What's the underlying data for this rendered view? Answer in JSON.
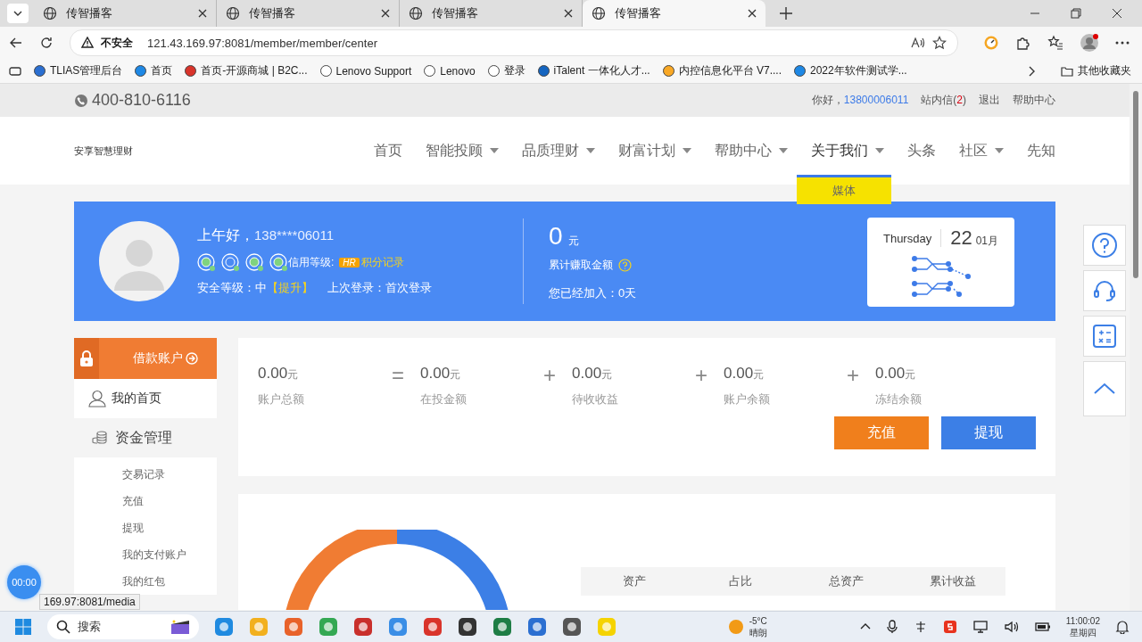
{
  "browser": {
    "tabs": [
      {
        "title": "传智播客",
        "selected": false
      },
      {
        "title": "传智播客",
        "selected": false
      },
      {
        "title": "传智播客",
        "selected": false
      },
      {
        "title": "传智播客",
        "selected": true
      }
    ],
    "address": {
      "warning": "不安全",
      "url": "121.43.169.97:8081/member/member/center"
    },
    "bookmarks": [
      "TLIAS管理后台",
      "首页",
      "首页-开源商城 | B2C...",
      "Lenovo Support",
      "Lenovo",
      "登录",
      "iTalent 一体化人才...",
      "内控信息化平台 V7....",
      "2022年软件测试学..."
    ],
    "other_bookmarks": "其他收藏夹"
  },
  "topbar": {
    "phone": "400-810-6116",
    "greeting": "你好，",
    "user": "13800006011",
    "inbox_open": "站内信(",
    "inbox_count": "2",
    "inbox_close": ")",
    "logout": "退出",
    "help": "帮助中心"
  },
  "nav": {
    "brand": "安享智慧理财",
    "items": [
      {
        "label": "首页",
        "dropdown": false,
        "expanded": false
      },
      {
        "label": "智能投顾",
        "dropdown": true,
        "expanded": false
      },
      {
        "label": "品质理财",
        "dropdown": true,
        "expanded": false
      },
      {
        "label": "财富计划",
        "dropdown": true,
        "expanded": false
      },
      {
        "label": "帮助中心",
        "dropdown": true,
        "expanded": false
      },
      {
        "label": "关于我们",
        "dropdown": true,
        "expanded": true,
        "menu": [
          "媒体"
        ]
      },
      {
        "label": "头条",
        "dropdown": false,
        "expanded": false
      },
      {
        "label": "社区",
        "dropdown": true,
        "expanded": false
      },
      {
        "label": "先知",
        "dropdown": false,
        "expanded": false
      }
    ]
  },
  "profile": {
    "greeting": "上午好，",
    "user": "138****06011",
    "credit_label": "信用等级:",
    "credit_badge": "HR",
    "points_link": "积分记录",
    "security": "安全等级：中",
    "upgrade": "【提升】",
    "last_login": "上次登录：首次登录",
    "earned": "0",
    "earned_unit": "元",
    "earned_label": "累计赚取金额",
    "joined": "您已经加入：0天",
    "date": {
      "weekday": "Thursday",
      "day": "22",
      "month": "01月"
    }
  },
  "sidebar": {
    "account": "借款账户",
    "home": "我的首页",
    "section": "资金管理",
    "items": [
      "交易记录",
      "充值",
      "提现",
      "我的支付账户",
      "我的红包"
    ]
  },
  "stats": [
    {
      "value": "0.00",
      "unit": "元",
      "label": "账户总额"
    },
    {
      "op": "=",
      "value": "0.00",
      "unit": "元",
      "label": "在投金额"
    },
    {
      "op": "+",
      "value": "0.00",
      "unit": "元",
      "label": "待收收益"
    },
    {
      "op": "+",
      "value": "0.00",
      "unit": "元",
      "label": "账户余额"
    },
    {
      "op": "+",
      "value": "0.00",
      "unit": "元",
      "label": "冻结余额"
    }
  ],
  "actions": [
    {
      "label": "充值",
      "kind": "recharge"
    },
    {
      "label": "提现",
      "kind": "withdraw"
    }
  ],
  "asset_table": {
    "columns": [
      "资产",
      "占比",
      "总资产",
      "累计收益"
    ]
  },
  "status_url": "169.97:8081/media",
  "recorder": "00:00",
  "taskbar": {
    "search": "搜索",
    "temperature": "-5°C",
    "weather": "晴朗",
    "time": "11:00:02",
    "day": "星期四"
  }
}
